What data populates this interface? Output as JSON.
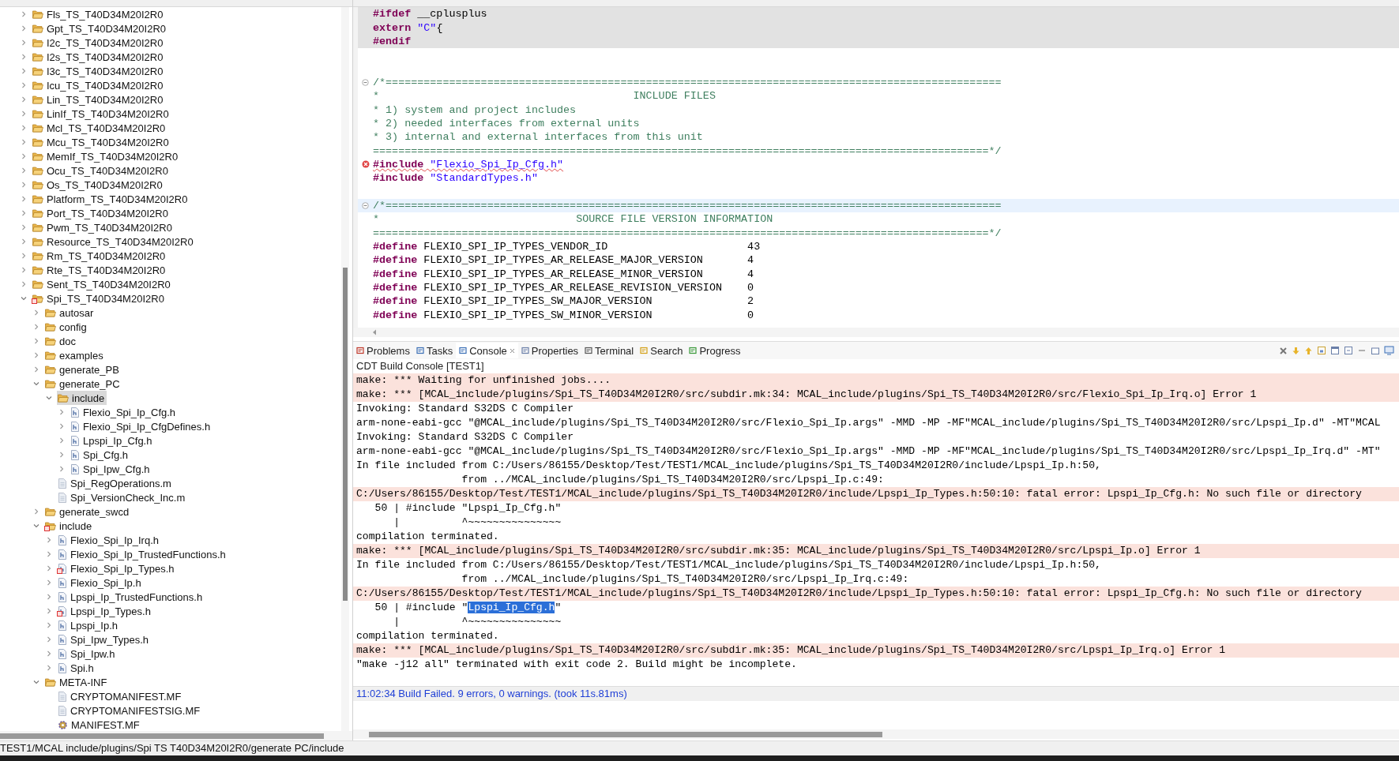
{
  "explorer": {
    "items": [
      {
        "label": "Fls_TS_T40D34M20I2R0",
        "kind": "folder",
        "expanded": false,
        "selected": false,
        "error": false
      },
      {
        "label": "Gpt_TS_T40D34M20I2R0",
        "kind": "folder",
        "expanded": false,
        "selected": false,
        "error": false
      },
      {
        "label": "I2c_TS_T40D34M20I2R0",
        "kind": "folder",
        "expanded": false,
        "selected": false,
        "error": false
      },
      {
        "label": "I2s_TS_T40D34M20I2R0",
        "kind": "folder",
        "expanded": false,
        "selected": false,
        "error": false
      },
      {
        "label": "I3c_TS_T40D34M20I2R0",
        "kind": "folder",
        "expanded": false,
        "selected": false,
        "error": false
      },
      {
        "label": "Icu_TS_T40D34M20I2R0",
        "kind": "folder",
        "expanded": false,
        "selected": false,
        "error": false
      },
      {
        "label": "Lin_TS_T40D34M20I2R0",
        "kind": "folder",
        "expanded": false,
        "selected": false,
        "error": false
      },
      {
        "label": "LinIf_TS_T40D34M20I2R0",
        "kind": "folder",
        "expanded": false,
        "selected": false,
        "error": false
      },
      {
        "label": "Mcl_TS_T40D34M20I2R0",
        "kind": "folder",
        "expanded": false,
        "selected": false,
        "error": false
      },
      {
        "label": "Mcu_TS_T40D34M20I2R0",
        "kind": "folder",
        "expanded": false,
        "selected": false,
        "error": false
      },
      {
        "label": "MemIf_TS_T40D34M20I2R0",
        "kind": "folder",
        "expanded": false,
        "selected": false,
        "error": false
      },
      {
        "label": "Ocu_TS_T40D34M20I2R0",
        "kind": "folder",
        "expanded": false,
        "selected": false,
        "error": false
      },
      {
        "label": "Os_TS_T40D34M20I2R0",
        "kind": "folder",
        "expanded": false,
        "selected": false,
        "error": false
      },
      {
        "label": "Platform_TS_T40D34M20I2R0",
        "kind": "folder",
        "expanded": false,
        "selected": false,
        "error": false
      },
      {
        "label": "Port_TS_T40D34M20I2R0",
        "kind": "folder",
        "expanded": false,
        "selected": false,
        "error": false
      },
      {
        "label": "Pwm_TS_T40D34M20I2R0",
        "kind": "folder",
        "expanded": false,
        "selected": false,
        "error": false
      },
      {
        "label": "Resource_TS_T40D34M20I2R0",
        "kind": "folder",
        "expanded": false,
        "selected": false,
        "error": false
      },
      {
        "label": "Rm_TS_T40D34M20I2R0",
        "kind": "folder",
        "expanded": false,
        "selected": false,
        "error": false
      },
      {
        "label": "Rte_TS_T40D34M20I2R0",
        "kind": "folder",
        "expanded": false,
        "selected": false,
        "error": false
      },
      {
        "label": "Sent_TS_T40D34M20I2R0",
        "kind": "folder",
        "expanded": false,
        "selected": false,
        "error": false
      },
      {
        "label": "Spi_TS_T40D34M20I2R0",
        "kind": "folder",
        "expanded": true,
        "selected": false,
        "error": true,
        "children": [
          {
            "label": "autosar",
            "kind": "folder",
            "expanded": false,
            "selected": false,
            "error": false
          },
          {
            "label": "config",
            "kind": "folder",
            "expanded": false,
            "selected": false,
            "error": false
          },
          {
            "label": "doc",
            "kind": "folder",
            "expanded": false,
            "selected": false,
            "error": false
          },
          {
            "label": "examples",
            "kind": "folder",
            "expanded": false,
            "selected": false,
            "error": false
          },
          {
            "label": "generate_PB",
            "kind": "folder",
            "expanded": false,
            "selected": false,
            "error": false
          },
          {
            "label": "generate_PC",
            "kind": "folder",
            "expanded": true,
            "selected": false,
            "error": false,
            "children": [
              {
                "label": "include",
                "kind": "folder",
                "expanded": true,
                "selected": true,
                "error": false,
                "children": [
                  {
                    "label": "Flexio_Spi_Ip_Cfg.h",
                    "kind": "header",
                    "expanded": false,
                    "selected": false,
                    "error": false
                  },
                  {
                    "label": "Flexio_Spi_Ip_CfgDefines.h",
                    "kind": "header",
                    "expanded": false,
                    "selected": false,
                    "error": false
                  },
                  {
                    "label": "Lpspi_Ip_Cfg.h",
                    "kind": "header",
                    "expanded": false,
                    "selected": false,
                    "error": false
                  },
                  {
                    "label": "Spi_Cfg.h",
                    "kind": "header",
                    "expanded": false,
                    "selected": false,
                    "error": false
                  },
                  {
                    "label": "Spi_Ipw_Cfg.h",
                    "kind": "header",
                    "expanded": false,
                    "selected": false,
                    "error": false
                  }
                ]
              },
              {
                "label": "Spi_RegOperations.m",
                "kind": "file",
                "selected": false,
                "error": false
              },
              {
                "label": "Spi_VersionCheck_Inc.m",
                "kind": "file",
                "selected": false,
                "error": false
              }
            ]
          },
          {
            "label": "generate_swcd",
            "kind": "folder",
            "expanded": false,
            "selected": false,
            "error": false
          },
          {
            "label": "include",
            "kind": "folder",
            "expanded": true,
            "selected": false,
            "error": true,
            "children": [
              {
                "label": "Flexio_Spi_Ip_Irq.h",
                "kind": "header",
                "expanded": false,
                "selected": false,
                "error": false
              },
              {
                "label": "Flexio_Spi_Ip_TrustedFunctions.h",
                "kind": "header",
                "expanded": false,
                "selected": false,
                "error": false
              },
              {
                "label": "Flexio_Spi_Ip_Types.h",
                "kind": "header",
                "expanded": false,
                "selected": false,
                "error": true
              },
              {
                "label": "Flexio_Spi_Ip.h",
                "kind": "header",
                "expanded": false,
                "selected": false,
                "error": false
              },
              {
                "label": "Lpspi_Ip_TrustedFunctions.h",
                "kind": "header",
                "expanded": false,
                "selected": false,
                "error": false
              },
              {
                "label": "Lpspi_Ip_Types.h",
                "kind": "header",
                "expanded": false,
                "selected": false,
                "error": true
              },
              {
                "label": "Lpspi_Ip.h",
                "kind": "header",
                "expanded": false,
                "selected": false,
                "error": false
              },
              {
                "label": "Spi_Ipw_Types.h",
                "kind": "header",
                "expanded": false,
                "selected": false,
                "error": false
              },
              {
                "label": "Spi_Ipw.h",
                "kind": "header",
                "expanded": false,
                "selected": false,
                "error": false
              },
              {
                "label": "Spi.h",
                "kind": "header",
                "expanded": false,
                "selected": false,
                "error": false
              }
            ]
          },
          {
            "label": "META-INF",
            "kind": "folder",
            "expanded": true,
            "selected": false,
            "error": false,
            "children": [
              {
                "label": "CRYPTOMANIFEST.MF",
                "kind": "file",
                "selected": false,
                "error": false
              },
              {
                "label": "CRYPTOMANIFESTSIG.MF",
                "kind": "file",
                "selected": false,
                "error": false
              },
              {
                "label": "MANIFEST.MF",
                "kind": "manifest",
                "selected": false,
                "error": false
              }
            ]
          }
        ]
      }
    ]
  },
  "editor": {
    "lines": [
      {
        "kind": "inactive",
        "segments": [
          {
            "kind": "keyword",
            "text": "#ifdef"
          },
          {
            "kind": "plain",
            "text": " __cplusplus"
          }
        ]
      },
      {
        "kind": "inactive",
        "segments": [
          {
            "kind": "keyword",
            "text": "extern"
          },
          {
            "kind": "string",
            "text": " \"C\""
          },
          {
            "kind": "plain",
            "text": "{"
          }
        ]
      },
      {
        "kind": "inactive",
        "segments": [
          {
            "kind": "keyword",
            "text": "#endif"
          }
        ]
      },
      {
        "kind": "blank"
      },
      {
        "kind": "blank"
      },
      {
        "kind": "code",
        "foldable": true,
        "segments": [
          {
            "kind": "comment",
            "text": "/*================================================================================================="
          }
        ]
      },
      {
        "kind": "code",
        "segments": [
          {
            "kind": "comment",
            "text": "*                                        INCLUDE FILES"
          }
        ]
      },
      {
        "kind": "code",
        "segments": [
          {
            "kind": "comment",
            "text": "* 1) system and project includes"
          }
        ]
      },
      {
        "kind": "code",
        "segments": [
          {
            "kind": "comment",
            "text": "* 2) needed interfaces from external units"
          }
        ]
      },
      {
        "kind": "code",
        "segments": [
          {
            "kind": "comment",
            "text": "* 3) internal and external interfaces from this unit"
          }
        ]
      },
      {
        "kind": "code",
        "segments": [
          {
            "kind": "comment",
            "text": "=================================================================================================*/"
          }
        ]
      },
      {
        "kind": "code",
        "error": true,
        "segments": [
          {
            "kind": "keyword",
            "text": "#include"
          },
          {
            "kind": "string",
            "text": " \"Flexio_Spi_Ip_Cfg.h\""
          }
        ]
      },
      {
        "kind": "code",
        "segments": [
          {
            "kind": "keyword",
            "text": "#include"
          },
          {
            "kind": "string",
            "text": " \"StandardTypes.h\""
          }
        ]
      },
      {
        "kind": "blank"
      },
      {
        "kind": "current",
        "foldable": true,
        "segments": [
          {
            "kind": "comment",
            "text": "/*================================================================================================="
          }
        ]
      },
      {
        "kind": "code",
        "segments": [
          {
            "kind": "comment",
            "text": "*                               SOURCE FILE VERSION INFORMATION"
          }
        ]
      },
      {
        "kind": "code",
        "segments": [
          {
            "kind": "comment",
            "text": "=================================================================================================*/"
          }
        ]
      },
      {
        "kind": "code",
        "segments": [
          {
            "kind": "keyword",
            "text": "#define"
          },
          {
            "kind": "plain",
            "text": " FLEXIO_SPI_IP_TYPES_VENDOR_ID                      43"
          }
        ]
      },
      {
        "kind": "code",
        "segments": [
          {
            "kind": "keyword",
            "text": "#define"
          },
          {
            "kind": "plain",
            "text": " FLEXIO_SPI_IP_TYPES_AR_RELEASE_MAJOR_VERSION       4"
          }
        ]
      },
      {
        "kind": "code",
        "segments": [
          {
            "kind": "keyword",
            "text": "#define"
          },
          {
            "kind": "plain",
            "text": " FLEXIO_SPI_IP_TYPES_AR_RELEASE_MINOR_VERSION       4"
          }
        ]
      },
      {
        "kind": "code",
        "segments": [
          {
            "kind": "keyword",
            "text": "#define"
          },
          {
            "kind": "plain",
            "text": " FLEXIO_SPI_IP_TYPES_AR_RELEASE_REVISION_VERSION    0"
          }
        ]
      },
      {
        "kind": "code",
        "segments": [
          {
            "kind": "keyword",
            "text": "#define"
          },
          {
            "kind": "plain",
            "text": " FLEXIO_SPI_IP_TYPES_SW_MAJOR_VERSION               2"
          }
        ]
      },
      {
        "kind": "code",
        "segments": [
          {
            "kind": "keyword",
            "text": "#define"
          },
          {
            "kind": "plain",
            "text": " FLEXIO_SPI_IP_TYPES_SW_MINOR_VERSION               0"
          }
        ]
      }
    ]
  },
  "console_tabs": [
    {
      "label": "Problems",
      "selected": false
    },
    {
      "label": "Tasks",
      "selected": false
    },
    {
      "label": "Console",
      "selected": true
    },
    {
      "label": "Properties",
      "selected": false
    },
    {
      "label": "Terminal",
      "selected": false
    },
    {
      "label": "Search",
      "selected": false
    },
    {
      "label": "Progress",
      "selected": false
    }
  ],
  "console": {
    "title": "CDT Build Console [TEST1]",
    "lines": [
      {
        "kind": "error",
        "text": "make: *** Waiting for unfinished jobs...."
      },
      {
        "kind": "error",
        "text": "make: *** [MCAL_include/plugins/Spi_TS_T40D34M20I2R0/src/subdir.mk:34: MCAL_include/plugins/Spi_TS_T40D34M20I2R0/src/Flexio_Spi_Ip_Irq.o] Error 1"
      },
      {
        "kind": "normal",
        "text": "Invoking: Standard S32DS C Compiler"
      },
      {
        "kind": "normal",
        "text": "arm-none-eabi-gcc \"@MCAL_include/plugins/Spi_TS_T40D34M20I2R0/src/Flexio_Spi_Ip.args\" -MMD -MP -MF\"MCAL_include/plugins/Spi_TS_T40D34M20I2R0/src/Lpspi_Ip.d\" -MT\"MCAL"
      },
      {
        "kind": "normal",
        "text": "Invoking: Standard S32DS C Compiler"
      },
      {
        "kind": "normal",
        "text": "arm-none-eabi-gcc \"@MCAL_include/plugins/Spi_TS_T40D34M20I2R0/src/Flexio_Spi_Ip.args\" -MMD -MP -MF\"MCAL_include/plugins/Spi_TS_T40D34M20I2R0/src/Lpspi_Ip_Irq.d\" -MT\""
      },
      {
        "kind": "normal",
        "text": "In file included from C:/Users/86155/Desktop/Test/TEST1/MCAL_include/plugins/Spi_TS_T40D34M20I2R0/include/Lpspi_Ip.h:50,"
      },
      {
        "kind": "normal",
        "text": "                 from ../MCAL_include/plugins/Spi_TS_T40D34M20I2R0/src/Lpspi_Ip.c:49:"
      },
      {
        "kind": "error",
        "text": "C:/Users/86155/Desktop/Test/TEST1/MCAL_include/plugins/Spi_TS_T40D34M20I2R0/include/Lpspi_Ip_Types.h:50:10: fatal error: Lpspi_Ip_Cfg.h: No such file or directory"
      },
      {
        "kind": "normal",
        "text": "   50 | #include \"Lpspi_Ip_Cfg.h\""
      },
      {
        "kind": "normal",
        "text": "      |          ^~~~~~~~~~~~~~~~"
      },
      {
        "kind": "normal",
        "text": "compilation terminated."
      },
      {
        "kind": "error",
        "text": "make: *** [MCAL_include/plugins/Spi_TS_T40D34M20I2R0/src/subdir.mk:35: MCAL_include/plugins/Spi_TS_T40D34M20I2R0/src/Lpspi_Ip.o] Error 1"
      },
      {
        "kind": "normal",
        "text": "In file included from C:/Users/86155/Desktop/Test/TEST1/MCAL_include/plugins/Spi_TS_T40D34M20I2R0/include/Lpspi_Ip.h:50,"
      },
      {
        "kind": "normal",
        "text": "                 from ../MCAL_include/plugins/Spi_TS_T40D34M20I2R0/src/Lpspi_Ip_Irq.c:49:"
      },
      {
        "kind": "error",
        "text": "C:/Users/86155/Desktop/Test/TEST1/MCAL_include/plugins/Spi_TS_T40D34M20I2R0/include/Lpspi_Ip_Types.h:50:10: fatal error: Lpspi_Ip_Cfg.h: No such file or directory"
      },
      {
        "kind": "normal",
        "text": "   50 | #include \"",
        "selection": "Lpspi_Ip_Cfg.h",
        "text_after": "\""
      },
      {
        "kind": "normal",
        "text": "      |          ^~~~~~~~~~~~~~~~"
      },
      {
        "kind": "normal",
        "text": "compilation terminated."
      },
      {
        "kind": "error",
        "text": "make: *** [MCAL_include/plugins/Spi_TS_T40D34M20I2R0/src/subdir.mk:35: MCAL_include/plugins/Spi_TS_T40D34M20I2R0/src/Lpspi_Ip_Irq.o] Error 1"
      },
      {
        "kind": "normal",
        "text": "\"make -j12 all\" terminated with exit code 2. Build might be incomplete."
      },
      {
        "kind": "blank"
      },
      {
        "kind": "status",
        "text": "11:02:34 Build Failed. 9 errors, 0 warnings. (took 11s.81ms)"
      }
    ]
  },
  "status_bar": {
    "path": "TEST1/MCAL include/plugins/Spi TS T40D34M20I2R0/generate PC/include"
  }
}
